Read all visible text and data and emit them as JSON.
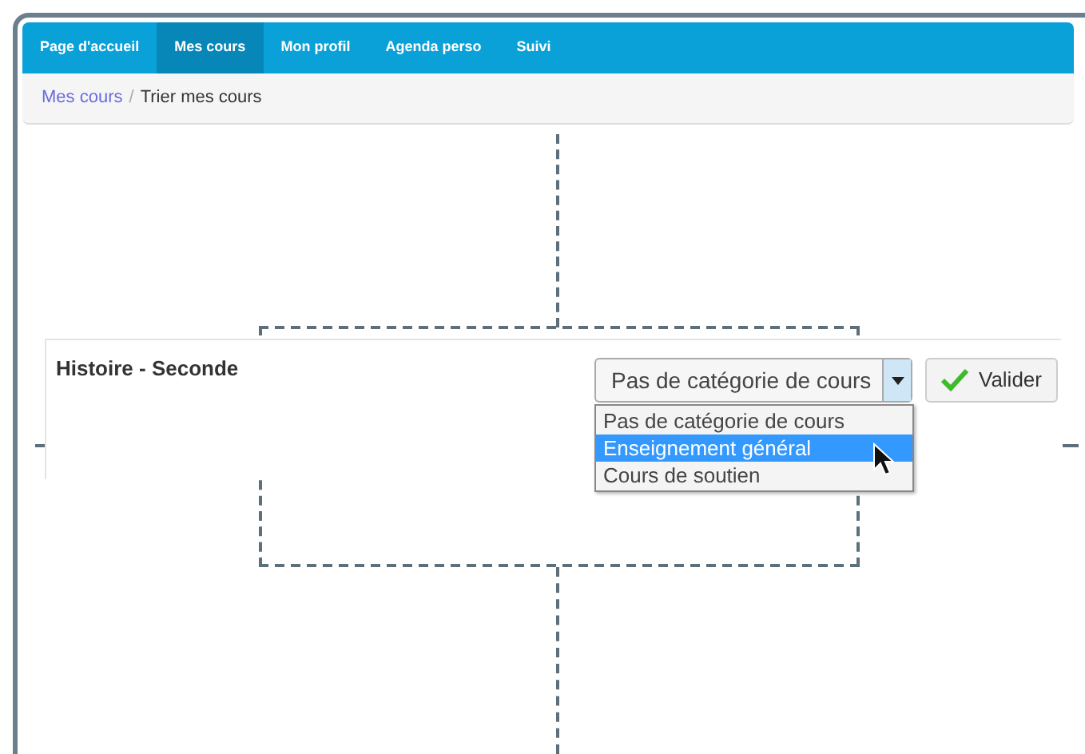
{
  "nav": {
    "tabs": [
      {
        "label": "Page d'accueil",
        "selected": false
      },
      {
        "label": "Mes cours",
        "selected": true
      },
      {
        "label": "Mon profil",
        "selected": false
      },
      {
        "label": "Agenda perso",
        "selected": false
      },
      {
        "label": "Suivi",
        "selected": false
      }
    ]
  },
  "breadcrumb": [
    {
      "label": "Mes cours",
      "kind": "link"
    },
    {
      "label": "/",
      "kind": "separator"
    },
    {
      "label": "Trier mes cours",
      "kind": "current"
    }
  ],
  "course": {
    "title": "Histoire - Seconde",
    "category_select": {
      "value": "Pas de catégorie de cours",
      "expanded": true,
      "options": [
        {
          "label": "Pas de catégorie de cours",
          "highlighted": false
        },
        {
          "label": "Enseignement général",
          "highlighted": true
        },
        {
          "label": "Cours de soutien",
          "highlighted": false
        }
      ]
    },
    "submit_button": "Valider"
  }
}
